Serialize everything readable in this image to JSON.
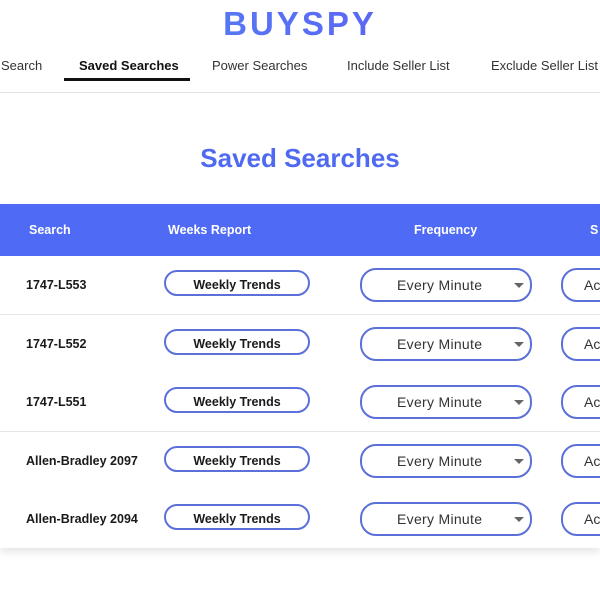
{
  "header": {
    "logo": "BUYSPY"
  },
  "nav": {
    "tabs": [
      {
        "label": "Search"
      },
      {
        "label": "Saved Searches",
        "active": true
      },
      {
        "label": "Power Searches"
      },
      {
        "label": "Include Seller List"
      },
      {
        "label": "Exclude Seller List"
      }
    ]
  },
  "main": {
    "title": "Saved Searches"
  },
  "table": {
    "columns": [
      "Search",
      "Weeks Report",
      "Frequency",
      "S"
    ],
    "rows": [
      {
        "search": "1747-L553",
        "report": "Weekly Trends",
        "frequency": "Every Minute",
        "status": "Ac"
      },
      {
        "search": "1747-L552",
        "report": "Weekly Trends",
        "frequency": "Every Minute",
        "status": "Ac"
      },
      {
        "search": "1747-L551",
        "report": "Weekly Trends",
        "frequency": "Every Minute",
        "status": "Ac"
      },
      {
        "search": "Allen-Bradley 2097",
        "report": "Weekly Trends",
        "frequency": "Every Minute",
        "status": "Ac"
      },
      {
        "search": "Allen-Bradley 2094",
        "report": "Weekly Trends",
        "frequency": "Every Minute",
        "status": "Ac"
      }
    ]
  },
  "colors": {
    "accent": "#4f6af5",
    "pill_border": "#5b70d8"
  }
}
